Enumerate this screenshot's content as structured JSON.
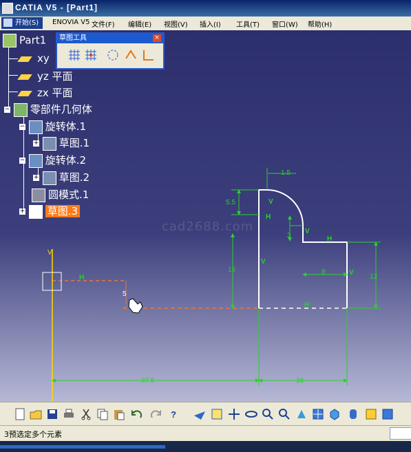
{
  "window": {
    "title": "CATIA V5 - [Part1]"
  },
  "menu": {
    "start": "开始(S)",
    "items": [
      "ENOVIA V5",
      "文件(F)",
      "编辑(E)",
      "视图(V)",
      "插入(I)",
      "工具(T)",
      "窗口(W)",
      "帮助(H)"
    ]
  },
  "tree": {
    "root": "Part1",
    "xy": "xy",
    "yz": "yz 平面",
    "zx": "zx 平面",
    "body": "零部件几何体",
    "shaft1": "旋转体.1",
    "sketch1": "草图.1",
    "shaft2": "旋转体.2",
    "sketch2": "草图.2",
    "pattern": "圆模式.1",
    "sketch3": "草图.3"
  },
  "sketch_toolbar": {
    "title": "草图工具",
    "close": "×"
  },
  "watermark": "cad2688.com",
  "dimensions": {
    "d1": "1.5",
    "d2": "5.5",
    "d3": "3",
    "d4": "16",
    "d5": "8",
    "d6": "12",
    "d7": "37.5",
    "d8": "16",
    "d9": "5"
  },
  "constraints": {
    "v": "V",
    "h": "H"
  },
  "axis": {
    "v_label": "V"
  },
  "status": {
    "message": "3预选定多个元素"
  },
  "colors": {
    "dimension": "#2bd02b",
    "profile": "#ffffff",
    "background": "#2c2f6c",
    "selection": "#ff7a18"
  },
  "icons": {
    "toolbar": [
      "new-icon",
      "open-icon",
      "save-icon",
      "print-icon",
      "cut-icon",
      "copy-icon",
      "paste-icon",
      "undo-icon",
      "redo-icon",
      "whats-this-icon",
      "fly-mode-icon",
      "fit-all-icon",
      "pan-icon",
      "rotate-icon",
      "zoom-in-icon",
      "zoom-out-icon",
      "normal-view-icon",
      "multi-view-icon",
      "iso-view-icon",
      "view-mode-icon",
      "hide-show-icon",
      "swap-space-icon"
    ]
  }
}
